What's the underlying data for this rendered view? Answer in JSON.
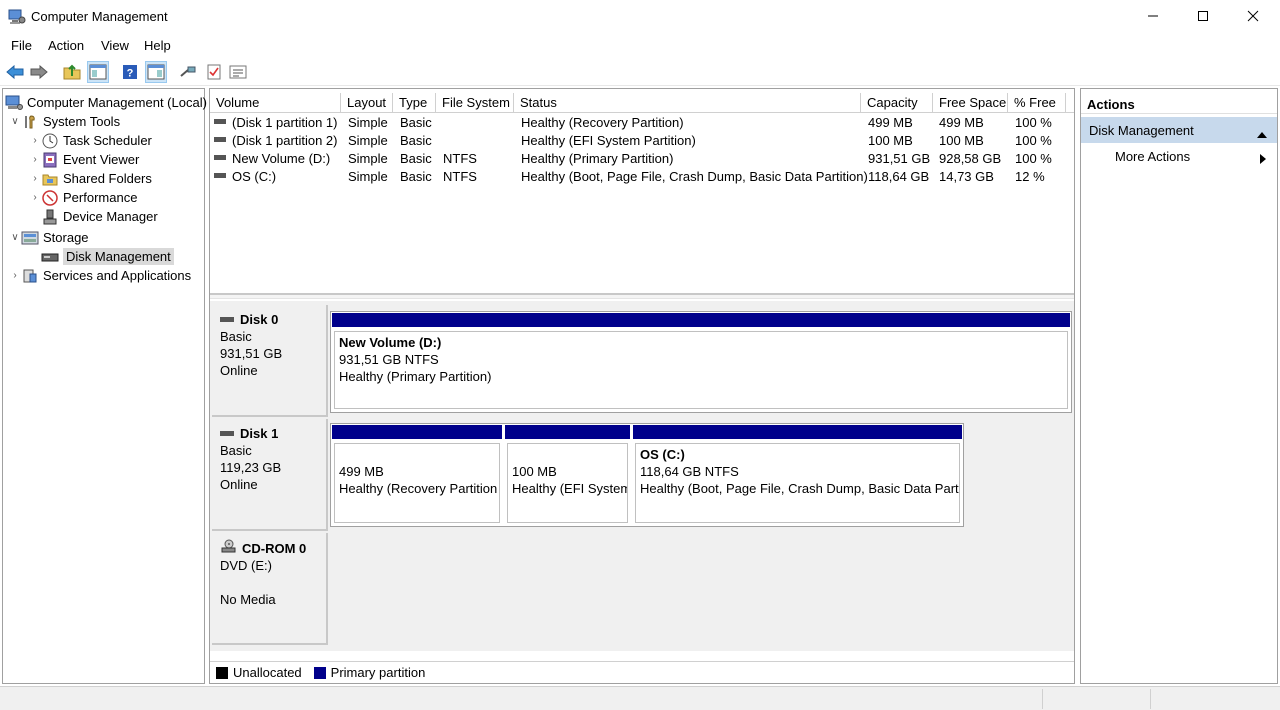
{
  "window": {
    "title": "Computer Management"
  },
  "menu": [
    "File",
    "Action",
    "View",
    "Help"
  ],
  "tree": {
    "root": "Computer Management (Local)",
    "system_tools": "System Tools",
    "task_scheduler": "Task Scheduler",
    "event_viewer": "Event Viewer",
    "shared_folders": "Shared Folders",
    "performance": "Performance",
    "device_manager": "Device Manager",
    "storage": "Storage",
    "disk_management": "Disk Management",
    "services": "Services and Applications"
  },
  "volume_table": {
    "headers": [
      "Volume",
      "Layout",
      "Type",
      "File System",
      "Status",
      "Capacity",
      "Free Space",
      "% Free"
    ],
    "rows": [
      [
        "(Disk 1 partition 1)",
        "Simple",
        "Basic",
        "",
        "Healthy (Recovery Partition)",
        "499 MB",
        "499 MB",
        "100 %"
      ],
      [
        "(Disk 1 partition 2)",
        "Simple",
        "Basic",
        "",
        "Healthy (EFI System Partition)",
        "100 MB",
        "100 MB",
        "100 %"
      ],
      [
        "New Volume (D:)",
        "Simple",
        "Basic",
        "NTFS",
        "Healthy (Primary Partition)",
        "931,51 GB",
        "928,58 GB",
        "100 %"
      ],
      [
        "OS (C:)",
        "Simple",
        "Basic",
        "NTFS",
        "Healthy (Boot, Page File, Crash Dump, Basic Data Partition)",
        "118,64 GB",
        "14,73 GB",
        "12 %"
      ]
    ]
  },
  "disks": {
    "disk0": {
      "name": "Disk 0",
      "type": "Basic",
      "size": "931,51 GB",
      "state": "Online",
      "p1": {
        "title": "New Volume  (D:)",
        "size": "931,51 GB NTFS",
        "status": "Healthy (Primary Partition)"
      }
    },
    "disk1": {
      "name": "Disk 1",
      "type": "Basic",
      "size": "119,23 GB",
      "state": "Online",
      "p1": {
        "size": "499 MB",
        "status": "Healthy (Recovery Partition"
      },
      "p2": {
        "size": "100 MB",
        "status": "Healthy (EFI System"
      },
      "p3": {
        "title": "OS  (C:)",
        "size": "118,64 GB NTFS",
        "status": "Healthy (Boot, Page File, Crash Dump, Basic Data Partit"
      }
    },
    "cdrom0": {
      "name": "CD-ROM 0",
      "drive": "DVD (E:)",
      "state": "No Media"
    }
  },
  "legend": {
    "unallocated": "Unallocated",
    "primary": "Primary partition"
  },
  "actions": {
    "header": "Actions",
    "section": "Disk Management",
    "more": "More Actions"
  },
  "colors": {
    "primary_partition": "#00008b",
    "unallocated": "#000000",
    "actions_section": "#c7d9ec"
  }
}
